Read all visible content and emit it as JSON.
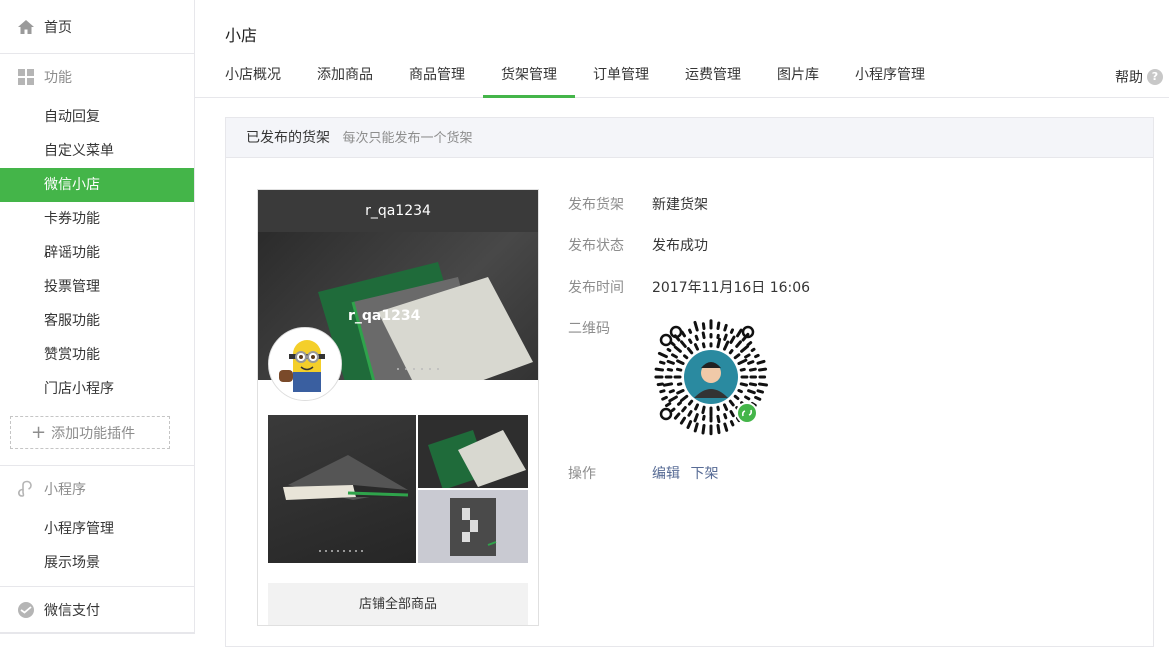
{
  "sidebar": {
    "home": "首页",
    "features_title": "功能",
    "features": [
      "自动回复",
      "自定义菜单",
      "微信小店",
      "卡券功能",
      "辟谣功能",
      "投票管理",
      "客服功能",
      "赞赏功能",
      "门店小程序"
    ],
    "active_index": 2,
    "add_plugin": "添加功能插件",
    "miniapp_title": "小程序",
    "miniapp_items": [
      "小程序管理",
      "展示场景"
    ],
    "wxpay": "微信支付"
  },
  "page": {
    "title": "小店"
  },
  "tabs": [
    "小店概况",
    "添加商品",
    "商品管理",
    "货架管理",
    "订单管理",
    "运费管理",
    "图片库",
    "小程序管理"
  ],
  "active_tab": "货架管理",
  "help": "帮助",
  "panel": {
    "title": "已发布的货架",
    "subtitle": "每次只能发布一个货架"
  },
  "preview": {
    "account": "r_qa1234",
    "shop_name": "r_qa1234",
    "all_goods": "店铺全部商品"
  },
  "info": {
    "shelf_label": "发布货架",
    "shelf_value": "新建货架",
    "status_label": "发布状态",
    "status_value": "发布成功",
    "time_label": "发布时间",
    "time_value": "2017年11月16日 16:06",
    "qr_label": "二维码",
    "ops_label": "操作",
    "edit": "编辑",
    "offline": "下架"
  },
  "colors": {
    "accent": "#44b549",
    "link": "#576b95"
  }
}
